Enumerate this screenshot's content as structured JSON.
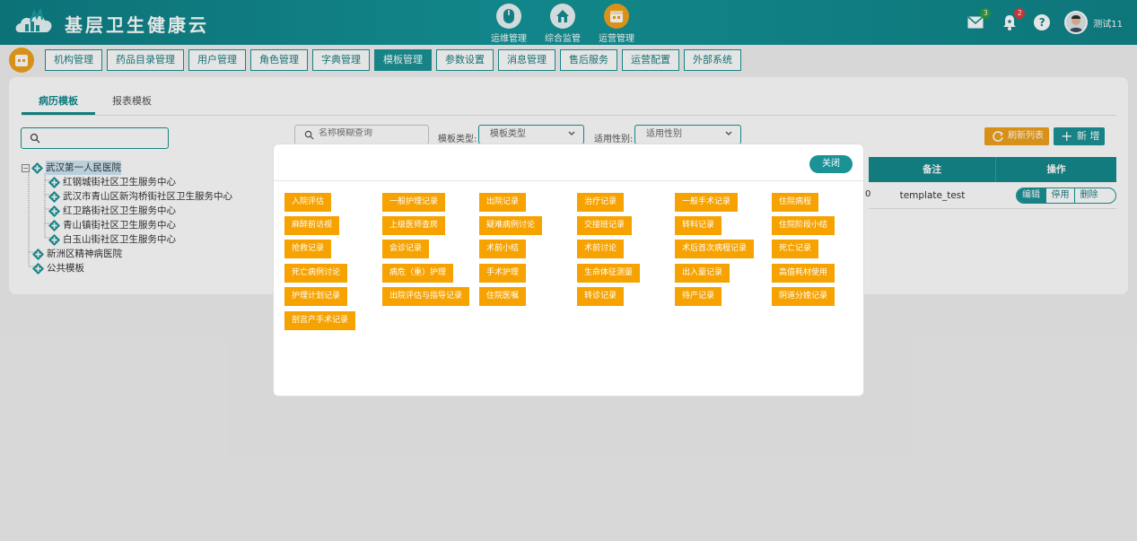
{
  "header": {
    "app_title": "基层卫生健康云",
    "nav": [
      {
        "label": "运维管理"
      },
      {
        "label": "综合监管"
      },
      {
        "label": "运营管理"
      }
    ],
    "mail_count": "3",
    "alert_count": "2",
    "help_symbol": "?",
    "username": "测试11"
  },
  "module_tabs": [
    "机构管理",
    "药品目录管理",
    "用户管理",
    "角色管理",
    "字典管理",
    "模板管理",
    "参数设置",
    "消息管理",
    "售后服务",
    "运营配置",
    "外部系统"
  ],
  "sub_tabs": [
    "病历模板",
    "报表模板"
  ],
  "tree": [
    {
      "label": "武汉第一人民医院"
    },
    {
      "label": "红钢城街社区卫生服务中心"
    },
    {
      "label": "武汉市青山区新沟桥街社区卫生服务中心"
    },
    {
      "label": "红卫路街社区卫生服务中心"
    },
    {
      "label": "青山镇街社区卫生服务中心"
    },
    {
      "label": "白玉山街社区卫生服务中心"
    },
    {
      "label": "新洲区精神病医院"
    },
    {
      "label": "公共模板"
    }
  ],
  "filters": {
    "name_placeholder": "名称模糊查询",
    "type_label": "模板类型:",
    "type_value": "模板类型",
    "gender_label": "适用性别:",
    "gender_value": "适用性别"
  },
  "actions": {
    "refresh": "刷新列表",
    "add": "新 增"
  },
  "table": {
    "headers": [
      "备注",
      "操作"
    ],
    "row_fragment": "0",
    "row_note": "template_test",
    "ops": [
      "编辑",
      "停用",
      "删除"
    ]
  },
  "modal": {
    "close": "关闭",
    "tags": [
      "入院评估",
      "一般护理记录",
      "出院记录",
      "治疗记录",
      "一般手术记录",
      "住院病程",
      "麻醉前访视",
      "上级医师查房",
      "疑难病例讨论",
      "交接班记录",
      "转科记录",
      "住院阶段小结",
      "抢救记录",
      "会诊记录",
      "术前小结",
      "术前讨论",
      "术后首次病程记录",
      "死亡记录",
      "死亡病例讨论",
      "病危（重）护理",
      "手术护理",
      "生命体征测量",
      "出入量记录",
      "高值耗材使用",
      "护理计划记录",
      "出院评估与指导记录",
      "住院医嘱",
      "转诊记录",
      "待产记录",
      "阴道分娩记录",
      "剖宫产手术记录"
    ]
  }
}
